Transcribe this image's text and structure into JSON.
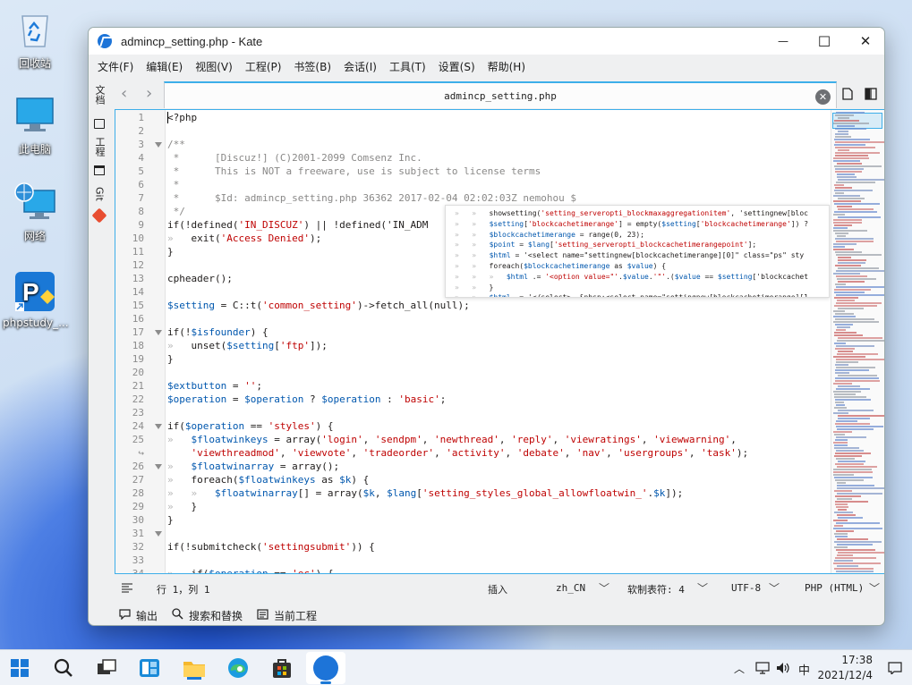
{
  "desktop": {
    "icons": [
      {
        "label": "回收站",
        "icon": "recycle-bin-icon"
      },
      {
        "label": "此电脑",
        "icon": "computer-icon"
      },
      {
        "label": "网络",
        "icon": "network-icon"
      },
      {
        "label": "phpstudy_...",
        "icon": "phpstudy-icon"
      }
    ]
  },
  "window": {
    "title": "admincp_setting.php  - Kate",
    "minimize": "—",
    "maximize": "☐",
    "close": "✕"
  },
  "menu": [
    "文件(F)",
    "编辑(E)",
    "视图(V)",
    "工程(P)",
    "书签(B)",
    "会话(I)",
    "工具(T)",
    "设置(S)",
    "帮助(H)"
  ],
  "sidebar": {
    "docs": "文档",
    "project": "工程",
    "git": "Git"
  },
  "tab": {
    "title": "admincp_setting.php",
    "back": "‹",
    "forward": "›"
  },
  "editor": {
    "line_numbers": [
      "1",
      "2",
      "3",
      "4",
      "5",
      "6",
      "7",
      "8",
      "9",
      "10",
      "11",
      "12",
      "13",
      "14",
      "15",
      "16",
      "17",
      "18",
      "19",
      "20",
      "21",
      "22",
      "23",
      "24",
      "25",
      "↪",
      "26",
      "27",
      "28",
      "29",
      "30",
      "31",
      "32",
      "33",
      "34"
    ],
    "code": [
      "<?php",
      "",
      "/**",
      " *      [Discuz!] (C)2001-2099 Comsenz Inc.",
      " *      This is NOT a freeware, use is subject to license terms",
      " *",
      " *      $Id: admincp_setting.php 36362 2017-02-04 02:02:03Z nemohou $",
      " */",
      "if(!defined('IN_DISCUZ') || !defined('IN_ADM",
      "»   exit('Access Denied');",
      "}",
      "",
      "cpheader();",
      "",
      "$setting = C::t('common_setting')->fetch_all(null);",
      "",
      "if(!$isfounder) {",
      "»   unset($setting['ftp']);",
      "}",
      "",
      "$extbutton = '';",
      "$operation = $operation ? $operation : 'basic';",
      "",
      "if($operation == 'styles') {",
      "»   $floatwinkeys = array('login', 'sendpm', 'newthread', 'reply', 'viewratings', 'viewwarning',",
      "    'viewthreadmod', 'viewvote', 'tradeorder', 'activity', 'debate', 'nav', 'usergroups', 'task');",
      "»   $floatwinarray = array();",
      "»   foreach($floatwinkeys as $k) {",
      "»   »   $floatwinarray[] = array($k, $lang['setting_styles_global_allowfloatwin_'.$k]);",
      "»   }",
      "}",
      "",
      "if(!submitcheck('settingsubmit')) {",
      "",
      "»   if($operation == 'ec') {"
    ],
    "popup": [
      "»   »   showsetting('setting_serveropti_blockmaxaggregationitem', 'settingnew[bloc",
      "»   »   $setting['blockcachetimerange'] = empty($setting['blockcachetimerange']) ?",
      "»   »   $blockcachetimerange = range(0, 23);",
      "»   »   $point = $lang['setting_serveropti_blockcachetimerangepoint'];",
      "»   »   $html = '<select name=\"settingnew[blockcachetimerange][0]\" class=\"ps\" sty",
      "»   »   foreach($blockcachetimerange as $value) {",
      "»   »   »   $html .= '<option value=\"'.$value.'\"'.($value == $setting['blockcachet",
      "»   »   }",
      "»   »   $html .= '</select>- &nbsp;<select name=\"settingnew[blockcachetimerange][1"
    ]
  },
  "status": {
    "position": "行 1，列 1",
    "mode": "插入",
    "dictionary": "zh_CN",
    "indent": "软制表符: 4",
    "encoding": "UTF-8",
    "syntax": "PHP (HTML)"
  },
  "tools": {
    "output": "输出",
    "search": "搜索和替换",
    "project": "当前工程"
  },
  "taskbar": {
    "time": "17:38",
    "date": "2021/12/4",
    "ime": "中",
    "tray_up": "︿"
  },
  "colors": {
    "accent": "#3daee9",
    "string": "#bf0303",
    "variable": "#0057ae",
    "comment": "#898887"
  }
}
